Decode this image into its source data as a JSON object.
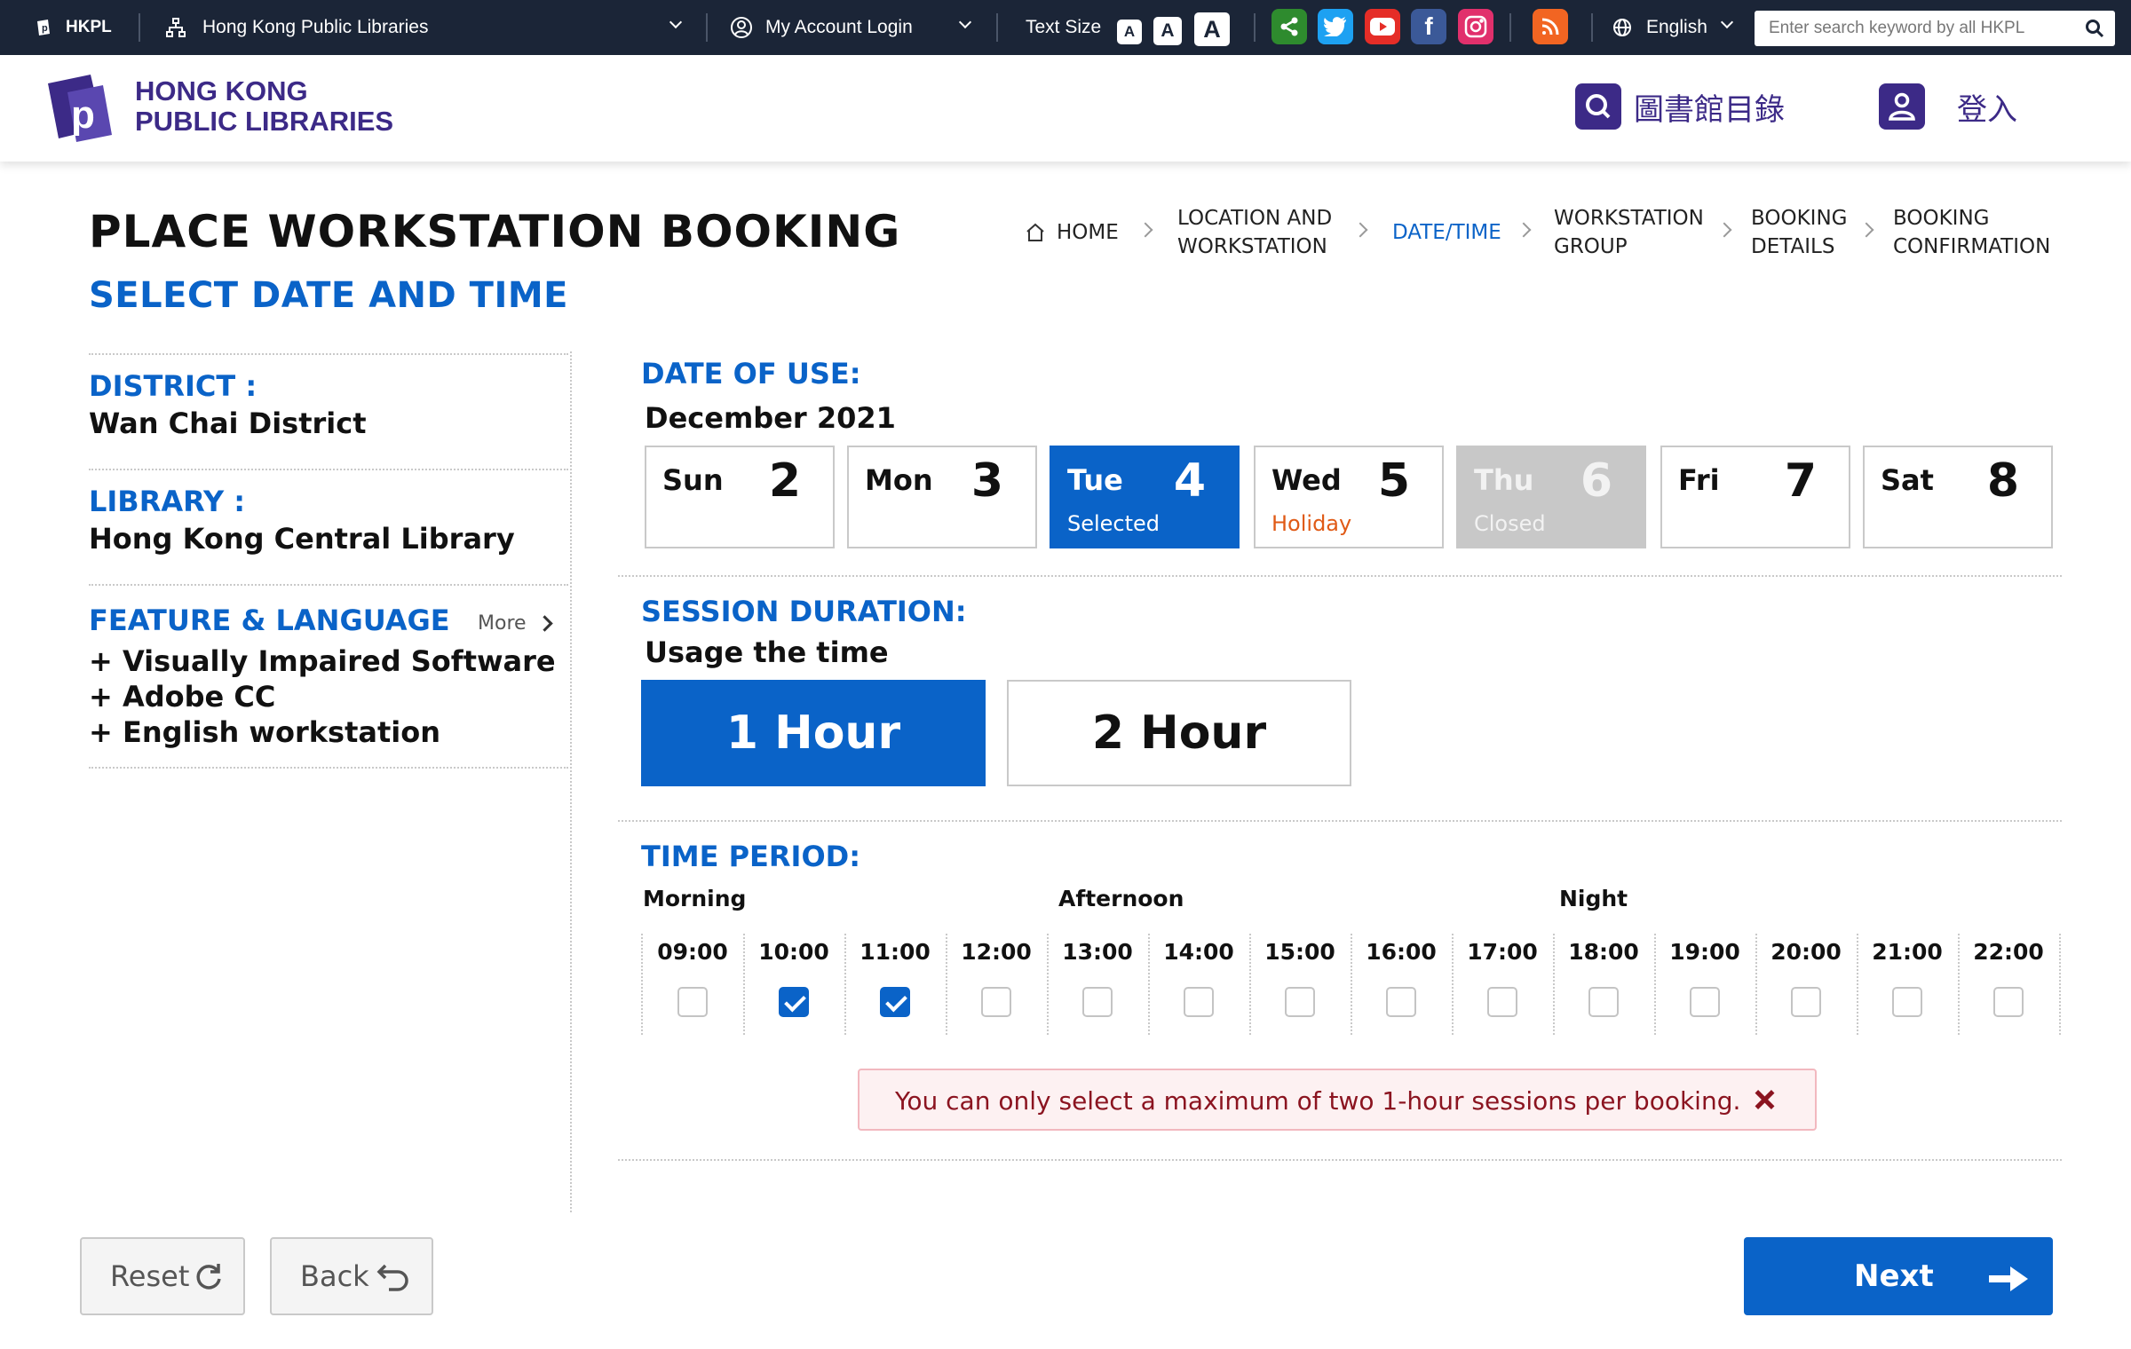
{
  "topbar": {
    "brand": "HKPL",
    "site_selector": "Hong Kong Public Libraries",
    "account": "My Account Login",
    "text_size_label": "Text Size",
    "text_size_options": [
      "A",
      "A",
      "A"
    ],
    "language": "English",
    "search_placeholder": "Enter search keyword by all HKPL"
  },
  "header": {
    "logo_line1": "HONG KONG",
    "logo_line2": "PUBLIC LIBRARIES",
    "catalogue": "圖書館目錄",
    "login": "登入"
  },
  "page": {
    "title": "PLACE WORKSTATION BOOKING",
    "subtitle": "SELECT DATE AND TIME"
  },
  "breadcrumb": {
    "home": "HOME",
    "step1_line1": "LOCATION AND",
    "step1_line2": "WORKSTATION",
    "step2": "DATE/TIME",
    "step3_line1": "WORKSTATION",
    "step3_line2": "GROUP",
    "step4_line1": "BOOKING",
    "step4_line2": "DETAILS",
    "step5_line1": "BOOKING",
    "step5_line2": "CONFIRMATION"
  },
  "sidebar": {
    "district_label": "DISTRICT :",
    "district_value": "Wan Chai District",
    "library_label": "LIBRARY :",
    "library_value": "Hong Kong Central Library",
    "feature_label": "FEATURE & LANGUAGE",
    "more": "More",
    "features": [
      "+ Visually Impaired Software",
      "+ Adobe CC",
      "+ English workstation"
    ]
  },
  "date_of_use": {
    "label": "DATE OF USE:",
    "month": "December 2021",
    "days": [
      {
        "name": "Sun",
        "date": "2",
        "status": ""
      },
      {
        "name": "Mon",
        "date": "3",
        "status": ""
      },
      {
        "name": "Tue",
        "date": "4",
        "status": "Selected"
      },
      {
        "name": "Wed",
        "date": "5",
        "status": "Holiday"
      },
      {
        "name": "Thu",
        "date": "6",
        "status": "Closed"
      },
      {
        "name": "Fri",
        "date": "7",
        "status": ""
      },
      {
        "name": "Sat",
        "date": "8",
        "status": ""
      }
    ]
  },
  "session": {
    "label": "SESSION DURATION:",
    "sub": "Usage the time",
    "options": [
      "1 Hour",
      "2 Hour"
    ],
    "selected": "1 Hour"
  },
  "time_period": {
    "label": "TIME PERIOD:",
    "groups": [
      "Morning",
      "Afternoon",
      "Night"
    ],
    "slots": [
      {
        "time": "09:00",
        "checked": false
      },
      {
        "time": "10:00",
        "checked": true
      },
      {
        "time": "11:00",
        "checked": true
      },
      {
        "time": "12:00",
        "checked": false
      },
      {
        "time": "13:00",
        "checked": false
      },
      {
        "time": "14:00",
        "checked": false
      },
      {
        "time": "15:00",
        "checked": false
      },
      {
        "time": "16:00",
        "checked": false
      },
      {
        "time": "17:00",
        "checked": false
      },
      {
        "time": "18:00",
        "checked": false
      },
      {
        "time": "19:00",
        "checked": false
      },
      {
        "time": "20:00",
        "checked": false
      },
      {
        "time": "21:00",
        "checked": false
      },
      {
        "time": "22:00",
        "checked": false
      }
    ]
  },
  "alert": {
    "message": "You can only select a maximum of two 1-hour sessions per booking."
  },
  "actions": {
    "reset": "Reset",
    "back": "Back",
    "next": "Next"
  },
  "colors": {
    "topbar_bg": "#1b2537",
    "brand_purple": "#3c2a87",
    "accent_blue": "#0a63c8",
    "holiday_orange": "#e05a16",
    "closed_gray": "#c8c8c8",
    "alert_text": "#8b1420"
  },
  "icons": {
    "social": [
      "share-icon",
      "twitter-icon",
      "youtube-icon",
      "facebook-icon",
      "instagram-icon",
      "rss-icon"
    ]
  }
}
